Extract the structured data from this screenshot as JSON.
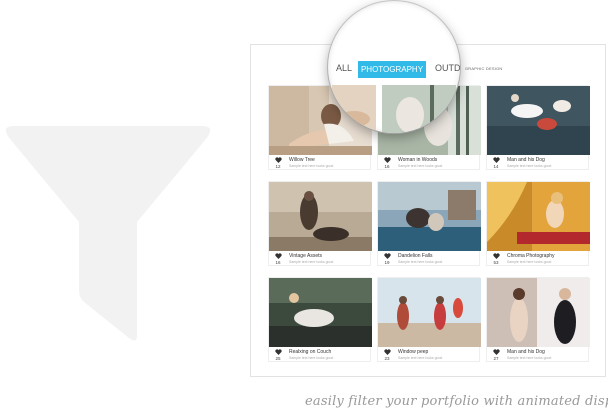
{
  "filters": {
    "all": "ALL",
    "photography": "PHOTOGRAPHY",
    "outdoor": "OUTD",
    "graphic_design": "GRAPHIC DESIGN"
  },
  "items": [
    {
      "title": "Willow Tree",
      "subtitle": "Sample text here looks good",
      "likes": "12"
    },
    {
      "title": "Woman in Woods",
      "subtitle": "Sample text here looks good",
      "likes": "16"
    },
    {
      "title": "Man and his Dog",
      "subtitle": "Sample text here looks good",
      "likes": "14"
    },
    {
      "title": "Vintage Assets",
      "subtitle": "Sample text here looks good",
      "likes": "16"
    },
    {
      "title": "Dandelion Falls",
      "subtitle": "Sample text here looks good",
      "likes": "19"
    },
    {
      "title": "Chroma Photography",
      "subtitle": "Sample text here looks good",
      "likes": "53"
    },
    {
      "title": "Realxing on Couch",
      "subtitle": "Sample text here looks good",
      "likes": "25"
    },
    {
      "title": "Window peep",
      "subtitle": "Sample text here looks good",
      "likes": "23"
    },
    {
      "title": "Man and his Dog",
      "subtitle": "Sample text here looks good",
      "likes": "27"
    }
  ],
  "caption": "easily filter your portfolio with animated display",
  "colors": {
    "accent": "#31b9e8",
    "funnel": "#f2f2f2"
  },
  "icons": {
    "filter": "funnel-icon",
    "like": "heart-icon"
  }
}
